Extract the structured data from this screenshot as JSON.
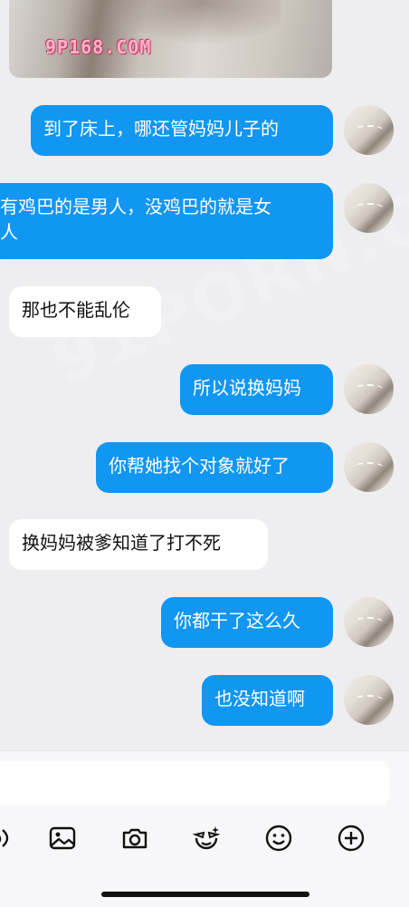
{
  "image_message": {
    "watermark": "9P168.COM"
  },
  "background_watermark": "91PORN.COM",
  "messages": [
    {
      "side": "out",
      "text": "到了床上，哪还管妈妈儿子的"
    },
    {
      "side": "out",
      "text": "有鸡巴的是男人，没鸡巴的就是女\n人"
    },
    {
      "side": "in",
      "text": "那也不能乱伦"
    },
    {
      "side": "out",
      "text": "所以说换妈妈"
    },
    {
      "side": "out",
      "text": "你帮她找个对象就好了"
    },
    {
      "side": "in",
      "text": "换妈妈被爹知道了打不死"
    },
    {
      "side": "out",
      "text": "你都干了这么久"
    },
    {
      "side": "out",
      "text": "也没知道啊"
    }
  ],
  "toolbar": {
    "icons": [
      "microphone-icon",
      "image-icon",
      "camera-icon",
      "sticker-icon",
      "emoji-icon",
      "plus-icon"
    ]
  },
  "colors": {
    "outgoing_bubble": "#1196f2",
    "incoming_bubble": "#ffffff",
    "background": "#eeeef1"
  }
}
